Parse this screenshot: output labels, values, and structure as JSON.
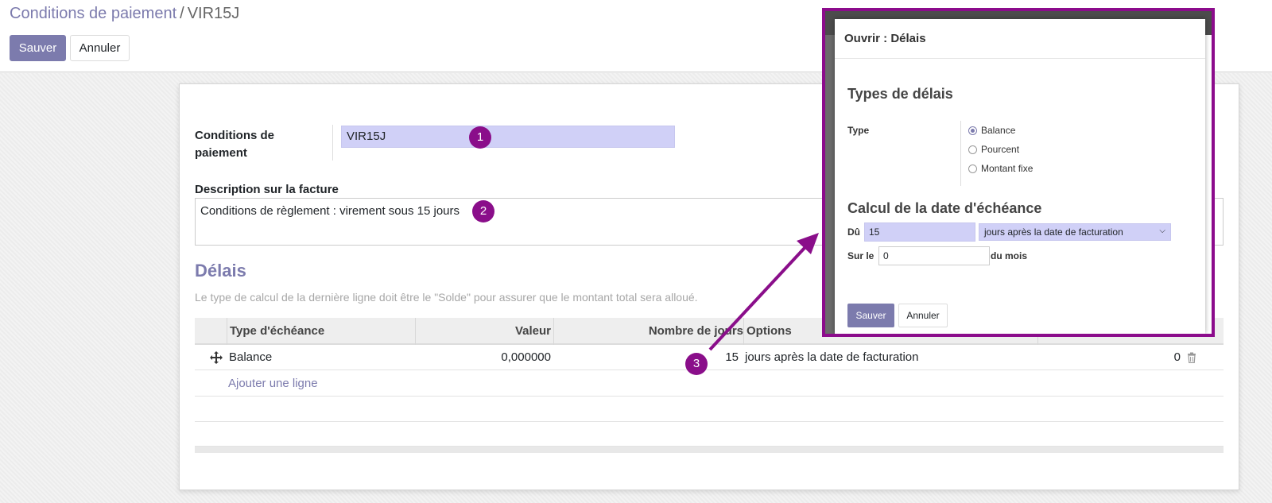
{
  "breadcrumb": {
    "parent": "Conditions de paiement",
    "separator": "/",
    "current": "VIR15J"
  },
  "toolbar": {
    "save_label": "Sauver",
    "cancel_label": "Annuler"
  },
  "form": {
    "name_label": "Conditions de paiement",
    "name_value": "VIR15J",
    "description_label": "Description sur la facture",
    "description_value": "Conditions de règlement : virement sous 15 jours",
    "section_title": "Délais",
    "hint": "Le type de calcul de la dernière ligne doit être le \"Solde\" pour assurer que le montant total sera alloué."
  },
  "table": {
    "columns": [
      "Type d'échéance",
      "Valeur",
      "Nombre de jours",
      "Options"
    ],
    "rows": [
      {
        "type": "Balance",
        "value": "0,000000",
        "days": "15",
        "options": "jours après la date de facturation",
        "extra": "0"
      }
    ],
    "add_line": "Ajouter une ligne"
  },
  "annotations": [
    "1",
    "2",
    "3"
  ],
  "dialog": {
    "title": "Ouvrir : Délais",
    "section1_title": "Types de délais",
    "type_label": "Type",
    "radio_options": [
      {
        "label": "Balance",
        "checked": true
      },
      {
        "label": "Pourcent",
        "checked": false
      },
      {
        "label": "Montant fixe",
        "checked": false
      }
    ],
    "section2_title": "Calcul de la date d'échéance",
    "due_label": "Dû",
    "due_value": "15",
    "due_option": "jours après la date de facturation",
    "on_label": "Sur le",
    "on_value": "0",
    "month_label": "du mois",
    "save_label": "Sauver",
    "cancel_label": "Annuler"
  },
  "colors": {
    "accent": "#7c7bad",
    "highlight_field": "#d0d0f7",
    "annotation": "#8a0e8a"
  },
  "icons": [
    "move-handle-icon",
    "trash-icon",
    "chevron-down-icon",
    "annotation-arrow"
  ]
}
